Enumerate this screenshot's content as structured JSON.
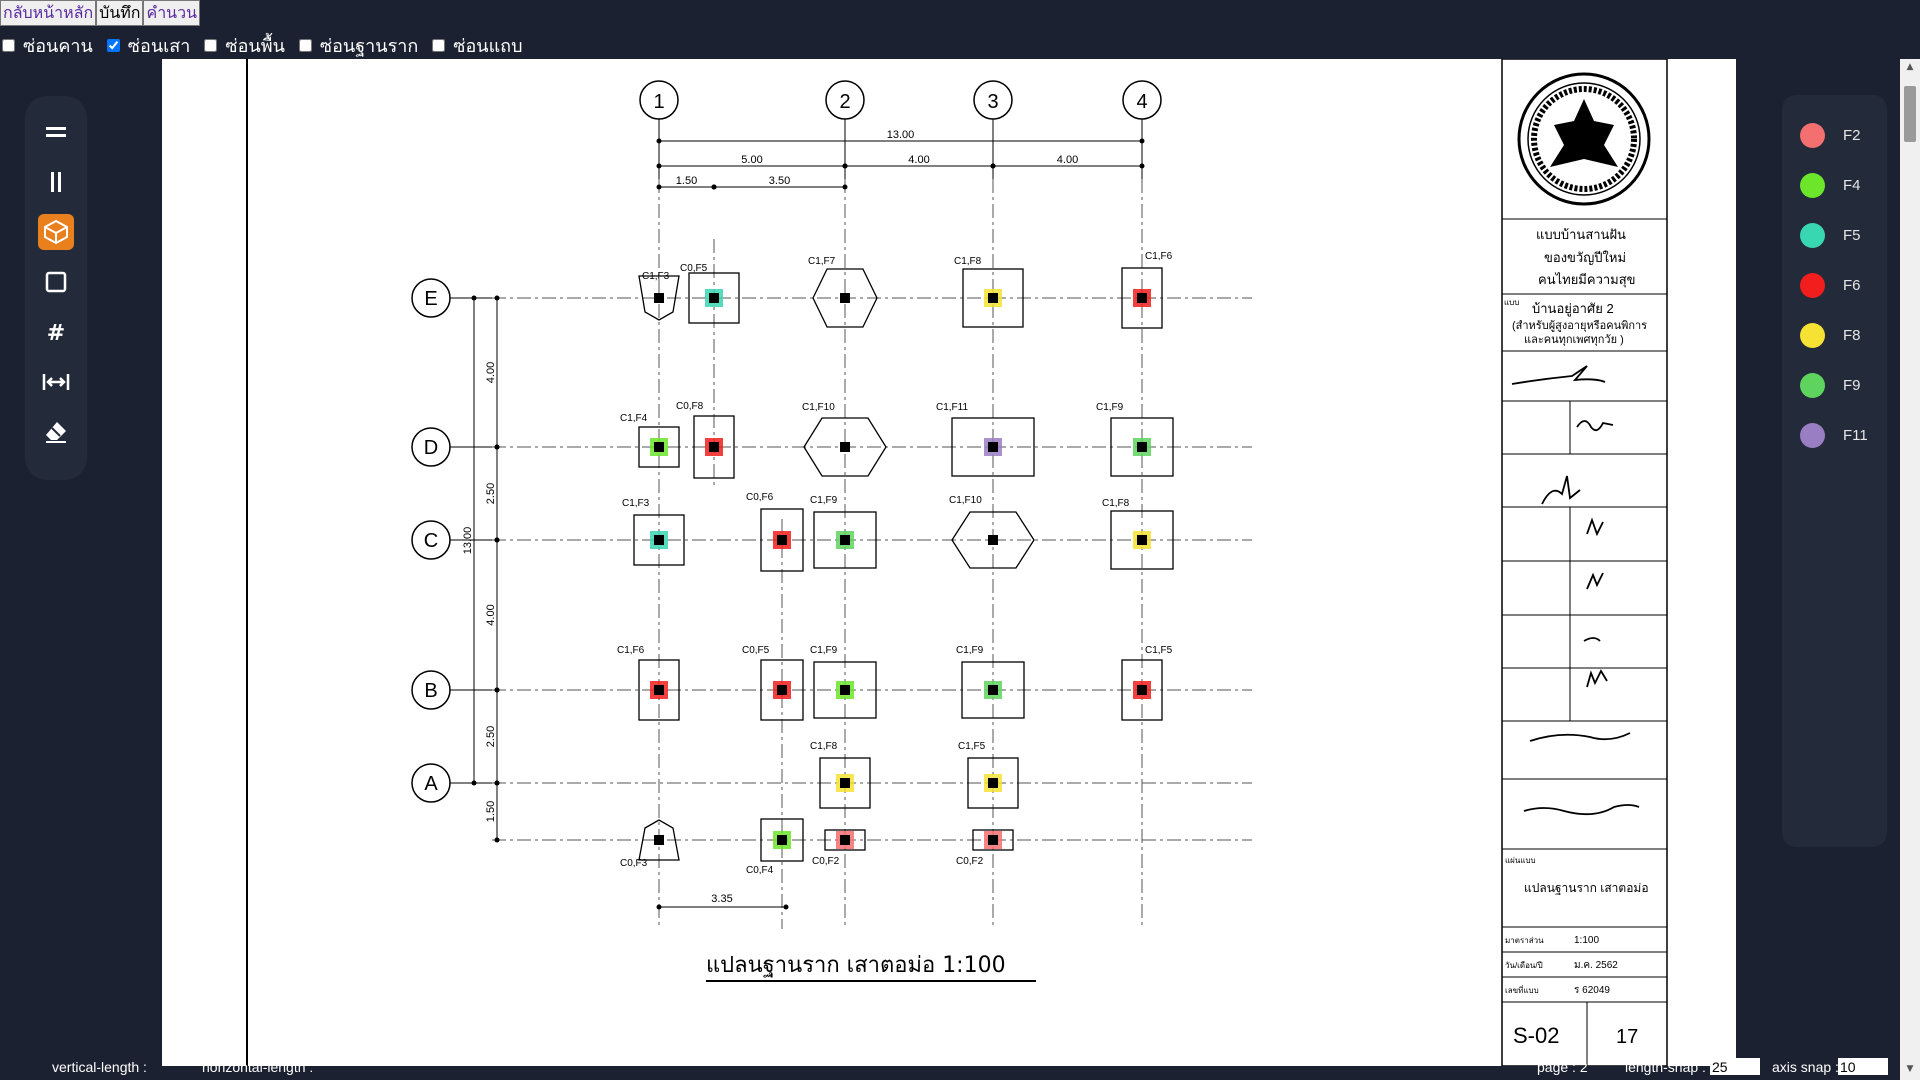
{
  "toolbar": {
    "buttons": [
      "กลับหน้าหลัก",
      "บันทึก",
      "คำนวน"
    ]
  },
  "filters": [
    {
      "label": "ซ่อนคาน",
      "checked": false
    },
    {
      "label": "ซ่อนเสา",
      "checked": true
    },
    {
      "label": "ซ่อนพื้น",
      "checked": false
    },
    {
      "label": "ซ่อนฐานราก",
      "checked": false
    },
    {
      "label": "ซ่อนแถบ",
      "checked": false
    }
  ],
  "tools": [
    {
      "icon": "horizontal-lines-icon"
    },
    {
      "icon": "vertical-lines-icon"
    },
    {
      "icon": "cube-icon",
      "active": true
    },
    {
      "icon": "square-icon"
    },
    {
      "icon": "hash-icon"
    },
    {
      "icon": "dimension-icon"
    },
    {
      "icon": "eraser-icon"
    }
  ],
  "legend": [
    {
      "label": "F2",
      "color": "#f46f6f"
    },
    {
      "label": "F4",
      "color": "#6be62a"
    },
    {
      "label": "F5",
      "color": "#38d6b1"
    },
    {
      "label": "F6",
      "color": "#f21d1d"
    },
    {
      "label": "F8",
      "color": "#f5e232"
    },
    {
      "label": "F9",
      "color": "#5ed35e"
    },
    {
      "label": "F11",
      "color": "#9a7ec4"
    }
  ],
  "status": {
    "vertical": "vertical-length :",
    "horizontal": "horizontal-length :",
    "page": "page : 2",
    "length_snap_label": "length-snap :",
    "length_snap_value": "25",
    "axis_snap_label": "axis snap :",
    "axis_snap_value": "10"
  },
  "drawing": {
    "title": "แปลนฐานราก  เสาตอม่อ   1:100",
    "columns": [
      "1",
      "2",
      "3",
      "4"
    ],
    "rows": [
      "E",
      "D",
      "C",
      "B",
      "A"
    ],
    "top_dims": [
      "13.00",
      "5.00",
      "4.00",
      "4.00",
      "1.50",
      "3.50"
    ],
    "side_dims": [
      "4.00",
      "2.50",
      "4.00",
      "2.50",
      "1.50",
      "13.00"
    ],
    "bottom_dim": "3.35",
    "labels": [
      "C1,F3",
      "C0,F5",
      "C1,F7",
      "C1,F8",
      "C1,F6",
      "C1,F4",
      "C0,F8",
      "C1,F10",
      "C1,F11",
      "C1,F9",
      "C1,F3",
      "C0,F6",
      "C1,F9",
      "C1,F10",
      "C1,F8",
      "C1,F6",
      "C0,F5",
      "C1,F9",
      "C1,F9",
      "C1,F5",
      "C1,F8",
      "C1,F5",
      "C0,F3",
      "C0,F4",
      "C0,F2",
      "C0,F2"
    ],
    "title_block": {
      "project": [
        "แบบบ้านสานฝัน",
        "ของขวัญปีใหม่",
        "คนไทยมีความสุข"
      ],
      "type_label": "แบบ",
      "type": [
        "บ้านอยู่อาศัย 2",
        "(สำหรับผู้สูงอายุหรือคนพิการ",
        "และคนทุกเพศทุกวัย )"
      ],
      "sheet_title_label": "แผ่นแบบ",
      "sheet_title": "แปลนฐานราก  เสาตอม่อ",
      "scale_label": "มาตราส่วน",
      "scale": "1:100",
      "date_label": "วัน/เดือน/ปี",
      "date": "ม.ค. 2562",
      "number_label": "เลขที่แบบ",
      "number": "ร 62049",
      "sheet_code": "S-02",
      "sheet_no": "17"
    }
  }
}
